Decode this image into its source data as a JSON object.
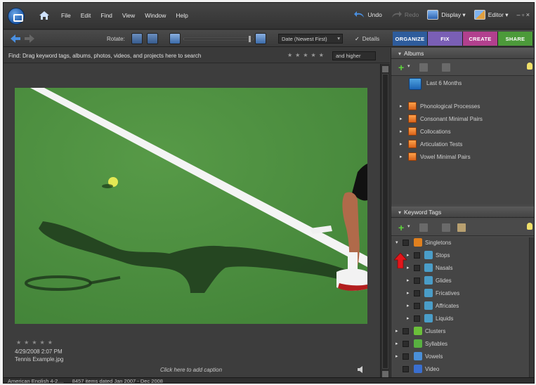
{
  "menubar": {
    "items": [
      "File",
      "Edit",
      "Find",
      "View",
      "Window",
      "Help"
    ],
    "undo": "Undo",
    "redo": "Redo",
    "display": "Display ▾",
    "editor": "Editor ▾",
    "window_controls": "– ▫ ×"
  },
  "toolbar": {
    "rotate_label": "Rotate:",
    "sort": "Date (Newest First)",
    "details": "Details",
    "details_check": "✓",
    "modes": [
      {
        "label": "ORGANIZE",
        "color": "#2e5c9c"
      },
      {
        "label": "FIX",
        "color": "#7a5fb5"
      },
      {
        "label": "CREATE",
        "color": "#b2408e"
      },
      {
        "label": "SHARE",
        "color": "#4c9a3a"
      }
    ]
  },
  "findbar": {
    "text": "Find: Drag keyword tags, albums, photos, videos, and projects here to search",
    "stars": "★★★★★",
    "rating_filter": "and higher"
  },
  "photo": {
    "stars": "★★★★★",
    "date": "4/29/2008 2:07 PM",
    "filename": "Tennis Example.jpg",
    "caption_placeholder": "Click here to add caption"
  },
  "albums": {
    "title": "Albums",
    "smart_album": "Last 6 Months",
    "items": [
      "Phonological Processes",
      "Consonant Minimal Pairs",
      "Collocations",
      "Articulation Tests",
      "Vowel Minimal Pairs"
    ]
  },
  "keyword_tags": {
    "title": "Keyword Tags",
    "items": [
      {
        "label": "Singletons",
        "level": 0,
        "color": "#e0801e",
        "expanded": true
      },
      {
        "label": "Stops",
        "level": 1,
        "color": "#4a9dc8"
      },
      {
        "label": "Nasals",
        "level": 1,
        "color": "#4a9dc8"
      },
      {
        "label": "Glides",
        "level": 1,
        "color": "#4a9dc8"
      },
      {
        "label": "Fricatives",
        "level": 1,
        "color": "#4a9dc8"
      },
      {
        "label": "Affricates",
        "level": 1,
        "color": "#4a9dc8"
      },
      {
        "label": "Liquids",
        "level": 1,
        "color": "#4a9dc8"
      },
      {
        "label": "Clusters",
        "level": 0,
        "color": "#6bbf3a"
      },
      {
        "label": "Syllables",
        "level": 0,
        "color": "#58b040"
      },
      {
        "label": "Vowels",
        "level": 0,
        "color": "#4a8fd8"
      },
      {
        "label": "Video",
        "level": 0,
        "color": "#3a6fd0"
      }
    ]
  },
  "statusbar": {
    "language": "American English 4-2....",
    "summary": "8457 items dated Jan 2007 - Dec 2008"
  }
}
